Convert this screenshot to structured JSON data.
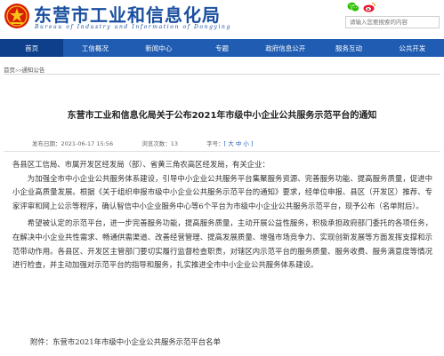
{
  "header": {
    "title": "东营市工业和信息化局",
    "subtitle": "Bureau of Industry and Information of Dongying",
    "search_placeholder": "请输入您要搜索的内容",
    "icons": [
      "emblem-icon",
      "wechat-icon",
      "weibo-icon"
    ]
  },
  "colors": {
    "brand_blue": "#1f5cb2",
    "nav_active": "#0e3f8a",
    "title_blue": "#1a4fa0",
    "weibo_red": "#e6162d",
    "wechat_green": "#2dc100"
  },
  "nav": {
    "items": [
      {
        "label": "首页",
        "active": true
      },
      {
        "label": "工信概况",
        "active": false
      },
      {
        "label": "新闻中心",
        "active": false
      },
      {
        "label": "专题",
        "active": false
      },
      {
        "label": "政府信息公开",
        "active": false
      },
      {
        "label": "服务互动",
        "active": false
      },
      {
        "label": "公共开发",
        "active": false
      }
    ]
  },
  "breadcrumb": {
    "home": "首页",
    "separator": ">>",
    "current": "通知公告"
  },
  "article": {
    "title": "东营市工业和信息化局关于公布2021年市级中小企业公共服务示范平台的通知",
    "publish_label": "发布日期：",
    "publish_date": "2021-06-17 15:56",
    "views_label": "浏览次数：",
    "views": "13",
    "font_label": "字号：",
    "font_options": "[ 大 中 小 ]",
    "salutation": "各县区工信局、市属开发区经发局（部）、省黄三角农高区经发局，有关企业：",
    "paragraph1": "为加强全市中小企业公共服务体系建设，引导中小企业公共服务平台集聚服务资源、完善服务功能、提高服务质量，促进中小企业高质量发展。根据《关于组织申报市级中小企业公共服务示范平台的通知》要求，经单位申报、县区（开发区）推荐、专家评审和网上公示等程序，确认智信中小企业服务中心等6个平台为市级中小企业公共服务示范平台，现予公布（名单附后）。",
    "paragraph2": "希望被认定的示范平台，进一步完善服务功能，提高服务质量，主动开展公益性服务，积极承担政府部门委托的各项任务，在解决中小企业共性需求、畅通供需渠道、改善经营管理、提高发展质量、增强市场竞争力、实现创新发展等方面发挥支撑和示范带动作用。各县区、开发区主管部门要切实履行监督检查职责，对辖区内示范平台的服务质量、服务收费、服务满意度等情况进行检查，并主动加强对示范平台的指导和服务，扎实推进全市中小企业公共服务体系建设。",
    "attachment": "附件：东营市2021年市级中小企业公共服务示范平台名单"
  }
}
